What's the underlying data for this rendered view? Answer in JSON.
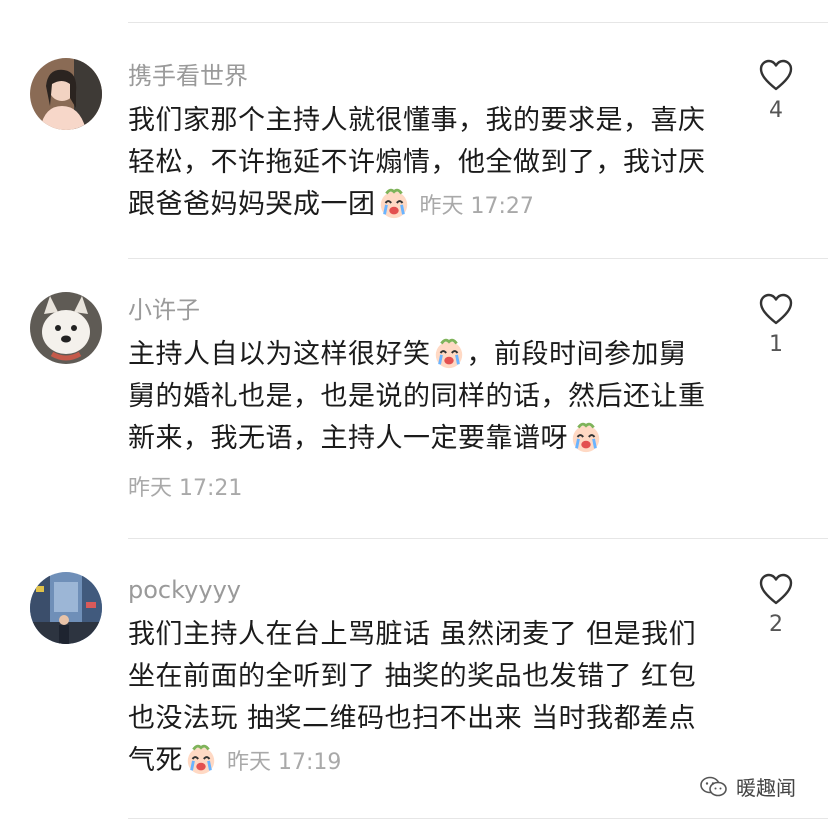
{
  "comments": [
    {
      "username": "携手看世界",
      "segments": [
        "我们家那个主持人就很懂事，我的要求是，喜庆轻松，不许拖延不许煽情，他全做到了，我讨厌跟爸爸妈妈哭成一团"
      ],
      "time": "昨天 17:27",
      "likes": "4"
    },
    {
      "username": "小许子",
      "seg1": "主持人自以为这样很好笑",
      "seg2": "，前段时间参加舅舅的婚礼也是，也是说的同样的话，然后还让重新来，我无语，主持人一定要靠谱呀",
      "time": "昨天 17:21",
      "likes": "1"
    },
    {
      "username": "pockyyyy",
      "seg1": "我们主持人在台上骂脏话 虽然闭麦了 但是我们坐在前面的全听到了 抽奖的奖品也发错了 红包也没法玩 抽奖二维码也扫不出来 当时我都差点气死",
      "time": "昨天 17:19",
      "likes": "2"
    }
  ],
  "watermark": {
    "text": "暖趣闻",
    "icon": "wechat-icon"
  },
  "emoji": {
    "name": "crying-face-emoji"
  }
}
